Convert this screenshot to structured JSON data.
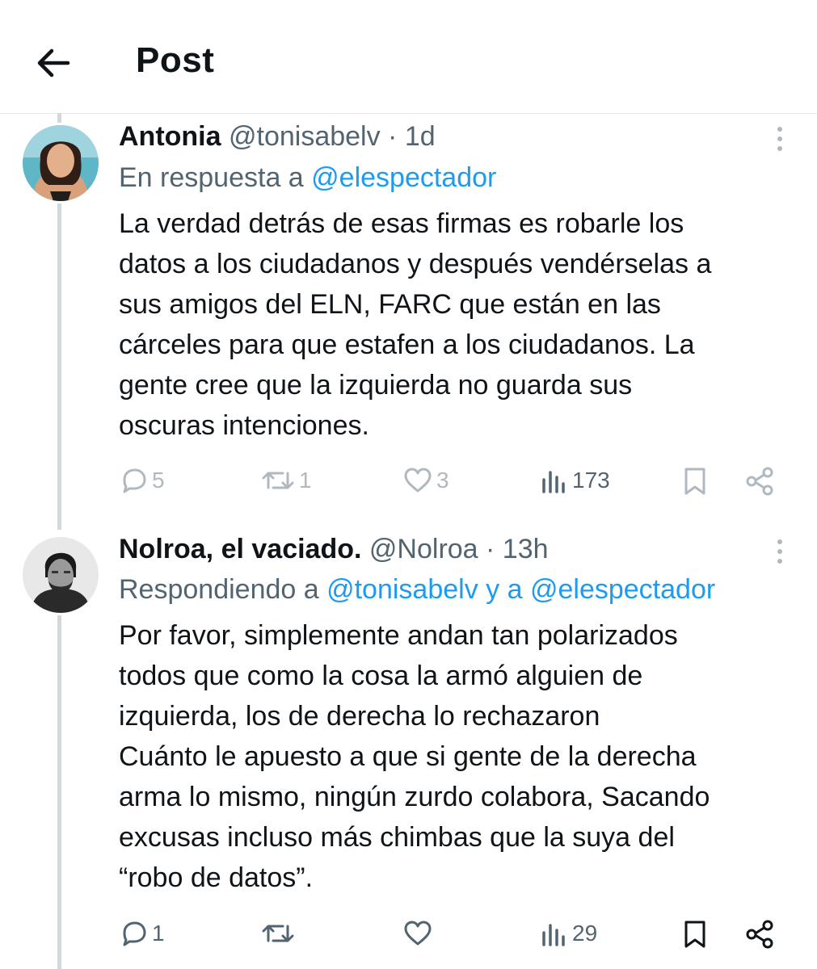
{
  "header": {
    "title": "Post"
  },
  "tweets": [
    {
      "display_name": "Antonia",
      "handle_time": "@tonisabelv · 1d",
      "reply_prefix": "En respuesta a ",
      "reply_links": [
        "@elespectador"
      ],
      "reply_joiner": "",
      "lines": [
        "La verdad detrás de esas firmas es robarle los",
        "datos a los ciudadanos y después vendérselas a",
        "sus amigos del ELN, FARC que están en las",
        "cárceles para que estafen a los ciudadanos. La",
        "gente cree que la izquierda no guarda sus",
        "oscuras intenciones."
      ],
      "stats": {
        "replies": "5",
        "reposts": "1",
        "likes": "3",
        "views": "173"
      }
    },
    {
      "display_name": "Nolroa, el vaciado.",
      "handle_time": "@Nolroa · 13h",
      "reply_prefix": "Respondiendo a ",
      "reply_links": [
        "@tonisabelv",
        "@elespectador"
      ],
      "reply_joiner": " y a ",
      "lines": [
        "Por favor, simplemente andan tan polarizados",
        "todos que como la cosa la armó alguien de",
        "izquierda, los de derecha lo rechazaron",
        "Cuánto le apuesto a que si gente de la derecha",
        "arma lo mismo, ningún zurdo colabora, Sacando",
        "excusas incluso más chimbas que la suya del",
        "“robo de datos”."
      ],
      "stats": {
        "replies": "1",
        "reposts": "",
        "likes": "",
        "views": "29"
      }
    }
  ],
  "icons": {
    "back": "arrow-left-icon",
    "more": "more-vertical-icon",
    "reply": "reply-icon",
    "repost": "repost-icon",
    "like": "heart-icon",
    "views": "views-icon",
    "bookmark": "bookmark-icon",
    "share": "share-icon"
  },
  "colors": {
    "link": "#1d9bf0",
    "secondary": "#536471",
    "muted": "#b0b9c0",
    "thread": "#cfd9de"
  }
}
